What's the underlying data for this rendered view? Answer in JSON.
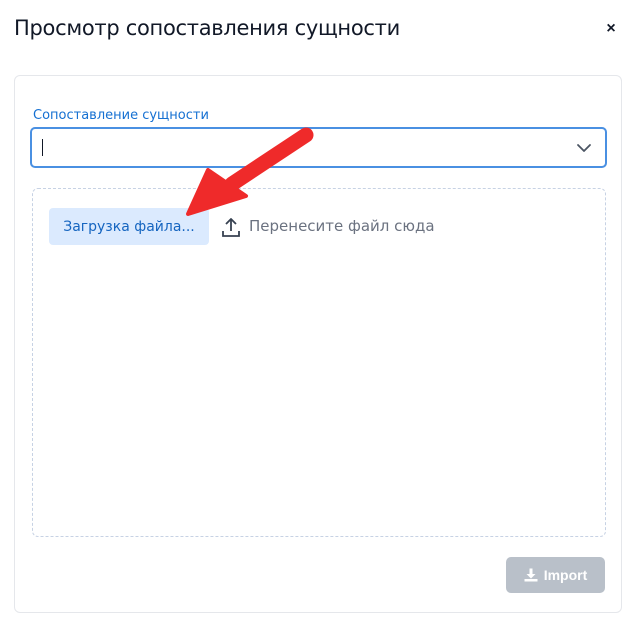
{
  "dialog": {
    "title": "Просмотр сопоставления сущности",
    "close_label": "×"
  },
  "entity_mapping": {
    "label": "Сопоставление сущности",
    "value": ""
  },
  "dropzone": {
    "upload_label": "Загрузка файла...",
    "drop_text": "Перенесите файл сюда"
  },
  "actions": {
    "import_label": "Import"
  },
  "colors": {
    "accent": "#1570d2",
    "focus_border": "#4a90e2",
    "upload_bg": "#dbeafe",
    "import_disabled_bg": "#b9c0c9",
    "annotation_arrow": "#ef2a2a"
  },
  "icons": {
    "close": "close-icon",
    "dropdown": "chevron-down-icon",
    "upload": "upload-icon",
    "import": "import-icon"
  }
}
